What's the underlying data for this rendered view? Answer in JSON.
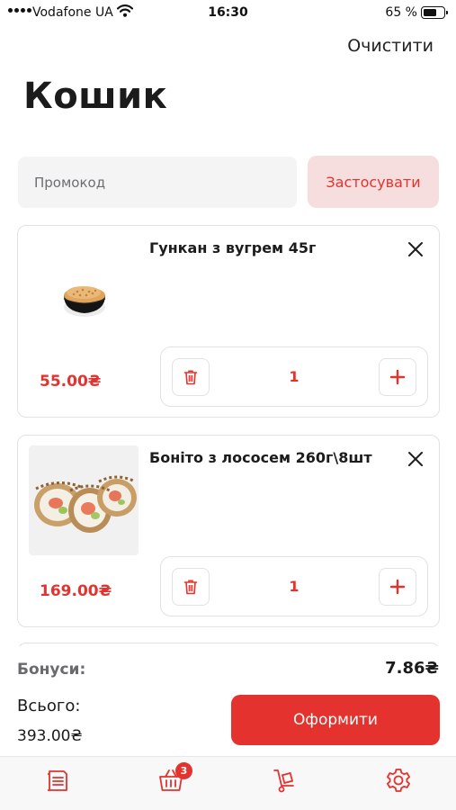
{
  "status_bar": {
    "carrier": "Vodafone UA",
    "time": "16:30",
    "battery": "65 %"
  },
  "header": {
    "clear_label": "Очистити",
    "title": "Кошик"
  },
  "promo": {
    "placeholder": "Промокод",
    "apply_label": "Застосувати"
  },
  "cart": {
    "items": [
      {
        "name": "Гункан з вугрем 45г",
        "price": "55.00₴",
        "quantity": "1",
        "image_icon": "gunkan-eel-image"
      },
      {
        "name": "Боніто з лососем 260г\\8шт",
        "price": "169.00₴",
        "quantity": "1",
        "image_icon": "bonito-salmon-roll-image"
      }
    ]
  },
  "summary": {
    "bonus_label": "Бонуси:",
    "bonus_value": "7.86₴",
    "total_label": "Всього:",
    "total_value": "393.00₴",
    "checkout_label": "Оформити"
  },
  "tab_bar": {
    "cart_badge": "3",
    "tabs": [
      "menu-icon",
      "cart-icon",
      "delivery-icon",
      "settings-icon"
    ]
  },
  "colors": {
    "accent": "#e4332e",
    "accent_light": "#f7dede",
    "input_bg": "#f4f4f5",
    "border": "#e2e2e6"
  }
}
